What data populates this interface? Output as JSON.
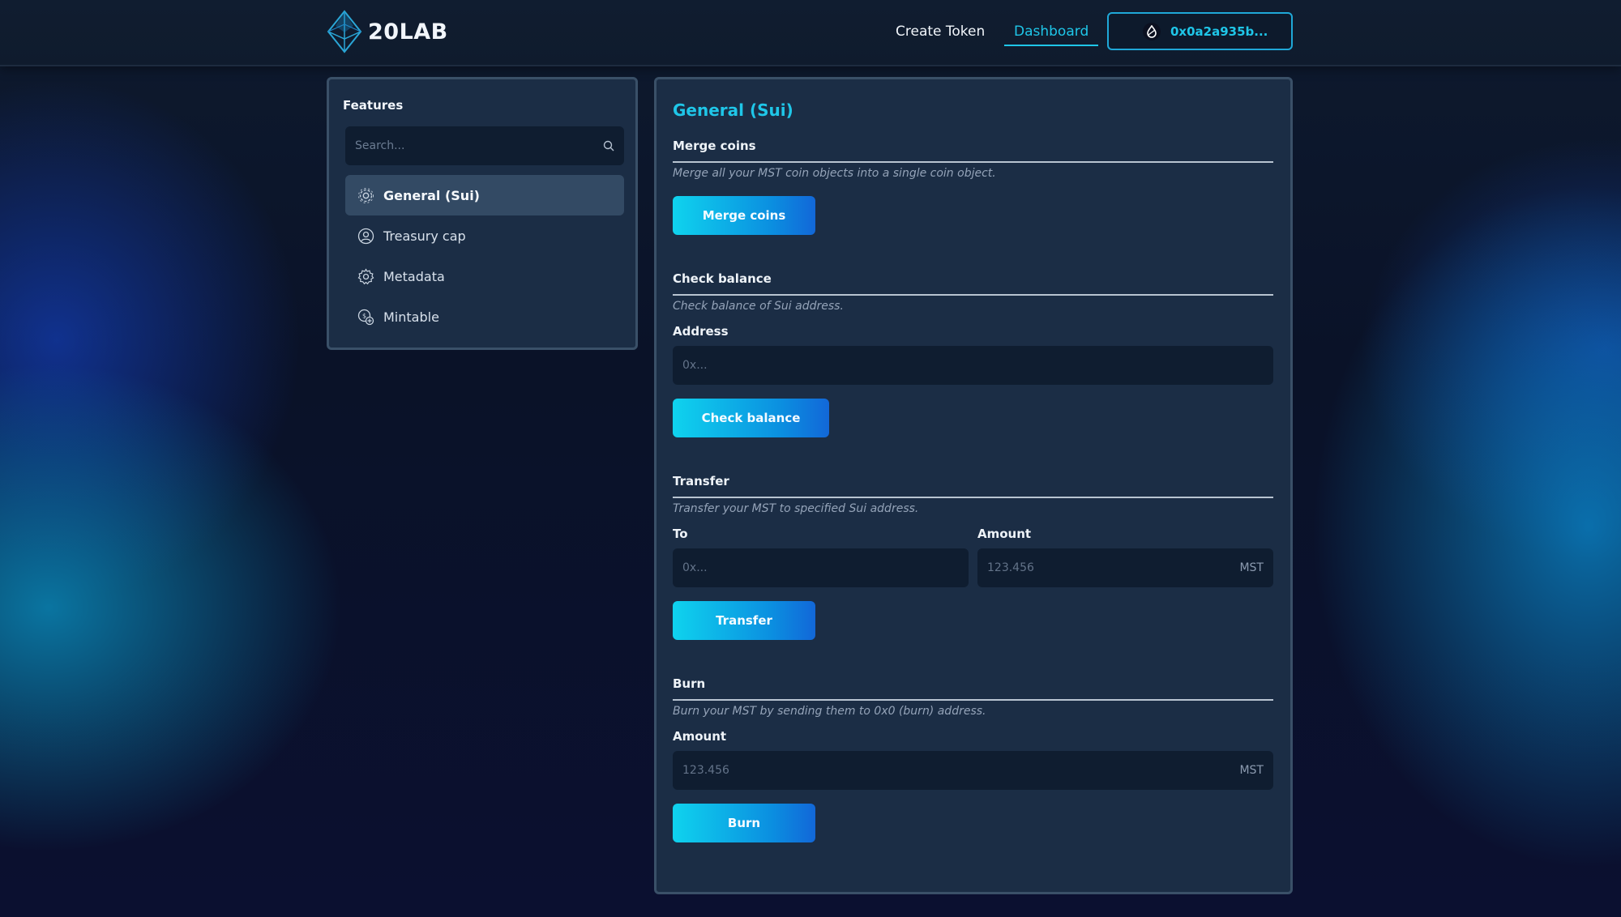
{
  "header": {
    "logo_text": "20LAB",
    "nav": {
      "create_token": "Create Token",
      "dashboard": "Dashboard"
    },
    "wallet_address": "0x0a2a935b..."
  },
  "sidebar": {
    "title": "Features",
    "search_placeholder": "Search...",
    "items": [
      {
        "label": "General (Sui)",
        "icon": "gear-icon",
        "active": true
      },
      {
        "label": "Treasury cap",
        "icon": "user-circle-icon",
        "active": false
      },
      {
        "label": "Metadata",
        "icon": "cog-icon",
        "active": false
      },
      {
        "label": "Mintable",
        "icon": "coin-add-icon",
        "active": false
      }
    ]
  },
  "main": {
    "title": "General (Sui)",
    "merge": {
      "title": "Merge coins",
      "desc": "Merge all your MST coin objects into a single coin object.",
      "button": "Merge coins"
    },
    "check_balance": {
      "title": "Check balance",
      "desc": "Check balance of Sui address.",
      "address_label": "Address",
      "address_placeholder": "0x...",
      "button": "Check balance"
    },
    "transfer": {
      "title": "Transfer",
      "desc": "Transfer your MST to specified Sui address.",
      "to_label": "To",
      "to_placeholder": "0x...",
      "amount_label": "Amount",
      "amount_placeholder": "123.456",
      "amount_suffix": "MST",
      "button": "Transfer"
    },
    "burn": {
      "title": "Burn",
      "desc": "Burn your MST by sending them to 0x0 (burn) address.",
      "amount_label": "Amount",
      "amount_placeholder": "123.456",
      "amount_suffix": "MST",
      "button": "Burn"
    }
  },
  "colors": {
    "accent": "#1fc6e8",
    "panel": "#1b2d45",
    "input_bg": "#0f1d30",
    "button_gradient": [
      "#0fd3ee",
      "#1267d8"
    ]
  }
}
